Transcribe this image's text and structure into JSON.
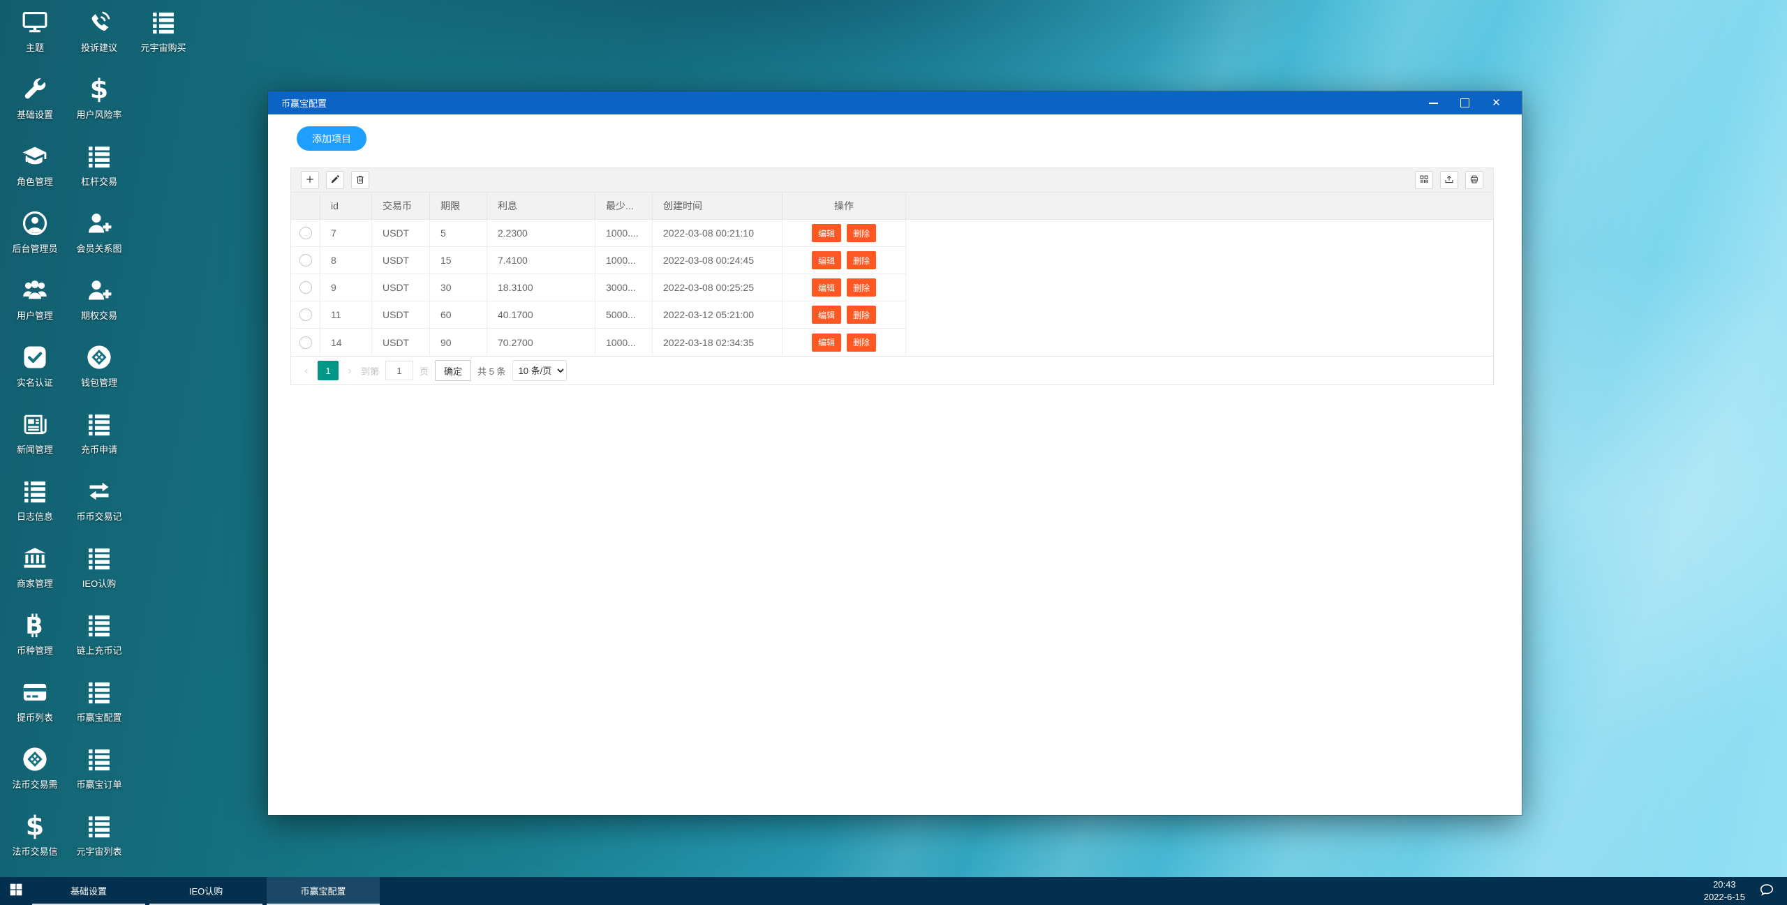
{
  "colors": {
    "accent_blue": "#1E9FFF",
    "titlebar_blue": "#0a63c5",
    "pager_active": "#009688",
    "danger_orange": "#FF5722",
    "taskbar_navy": "#04304f"
  },
  "desktop": {
    "icons": [
      {
        "label": "主题",
        "icon": "monitor",
        "col": 1,
        "row": 1
      },
      {
        "label": "投诉建议",
        "icon": "phone-waves",
        "col": 2,
        "row": 1
      },
      {
        "label": "元宇宙购买",
        "icon": "list",
        "col": 3,
        "row": 1
      },
      {
        "label": "基础设置",
        "icon": "wrench",
        "col": 1,
        "row": 2
      },
      {
        "label": "用户风险率",
        "icon": "dollar",
        "col": 2,
        "row": 2
      },
      {
        "label": "角色管理",
        "icon": "graduation-cap",
        "col": 1,
        "row": 3
      },
      {
        "label": "杠杆交易",
        "icon": "list",
        "col": 2,
        "row": 3
      },
      {
        "label": "后台管理员",
        "icon": "user-circle",
        "col": 1,
        "row": 4
      },
      {
        "label": "会员关系图",
        "icon": "user-plus",
        "col": 2,
        "row": 4
      },
      {
        "label": "用户管理",
        "icon": "users",
        "col": 1,
        "row": 5
      },
      {
        "label": "期权交易",
        "icon": "user-plus",
        "col": 2,
        "row": 5
      },
      {
        "label": "实名认证",
        "icon": "check-square",
        "col": 1,
        "row": 6
      },
      {
        "label": "钱包管理",
        "icon": "gem-circle",
        "col": 2,
        "row": 6
      },
      {
        "label": "新闻管理",
        "icon": "newspaper",
        "col": 1,
        "row": 7
      },
      {
        "label": "充币申请",
        "icon": "list",
        "col": 2,
        "row": 7
      },
      {
        "label": "日志信息",
        "icon": "list",
        "col": 1,
        "row": 8
      },
      {
        "label": "币币交易记",
        "icon": "swap-arrows",
        "col": 2,
        "row": 8
      },
      {
        "label": "商家管理",
        "icon": "bank",
        "col": 1,
        "row": 9
      },
      {
        "label": "IEO认购",
        "icon": "list",
        "col": 2,
        "row": 9
      },
      {
        "label": "币种管理",
        "icon": "bitcoin",
        "col": 1,
        "row": 10
      },
      {
        "label": "链上充币记",
        "icon": "list",
        "col": 2,
        "row": 10
      },
      {
        "label": "提币列表",
        "icon": "credit-card",
        "col": 1,
        "row": 11
      },
      {
        "label": "币赢宝配置",
        "icon": "list",
        "col": 2,
        "row": 11
      },
      {
        "label": "法币交易需",
        "icon": "gem-circle",
        "col": 1,
        "row": 12
      },
      {
        "label": "币赢宝订单",
        "icon": "list",
        "col": 2,
        "row": 12
      },
      {
        "label": "法币交易信",
        "icon": "dollar",
        "col": 1,
        "row": 13
      },
      {
        "label": "元宇宙列表",
        "icon": "list",
        "col": 2,
        "row": 13
      }
    ]
  },
  "window": {
    "title": "币赢宝配置",
    "controls": [
      "minimize",
      "maximize",
      "close"
    ],
    "add_button_label": "添加项目",
    "toolbar": {
      "icons_left": [
        "plus",
        "edit",
        "trash"
      ],
      "icons_right": [
        "columns",
        "export",
        "print"
      ]
    },
    "table": {
      "headers": [
        "id",
        "交易币",
        "期限",
        "利息",
        "最少...",
        "创建时间",
        "操作"
      ],
      "rows": [
        {
          "id": "7",
          "coin": "USDT",
          "term": "5",
          "interest": "2.2300",
          "min": "1000....",
          "created": "2022-03-08 00:21:10"
        },
        {
          "id": "8",
          "coin": "USDT",
          "term": "15",
          "interest": "7.4100",
          "min": "1000...",
          "created": "2022-03-08 00:24:45"
        },
        {
          "id": "9",
          "coin": "USDT",
          "term": "30",
          "interest": "18.3100",
          "min": "3000...",
          "created": "2022-03-08 00:25:25"
        },
        {
          "id": "11",
          "coin": "USDT",
          "term": "60",
          "interest": "40.1700",
          "min": "5000...",
          "created": "2022-03-12 05:21:00"
        },
        {
          "id": "14",
          "coin": "USDT",
          "term": "90",
          "interest": "70.2700",
          "min": "1000...",
          "created": "2022-03-18 02:34:35"
        }
      ],
      "action_edit": "编辑",
      "action_delete": "删除"
    },
    "pagination": {
      "prev": "‹",
      "next": "›",
      "current_page": "1",
      "goto_prefix": "到第",
      "goto_input_value": "1",
      "goto_suffix": "页",
      "confirm_label": "确定",
      "total_label": "共 5 条",
      "page_size_label": "10 条/页"
    }
  },
  "taskbar": {
    "items": [
      "基础设置",
      "IEO认购",
      "币赢宝配置"
    ],
    "active_item": "币赢宝配置",
    "clock": {
      "time": "20:43",
      "date": "2022-6-15"
    }
  }
}
